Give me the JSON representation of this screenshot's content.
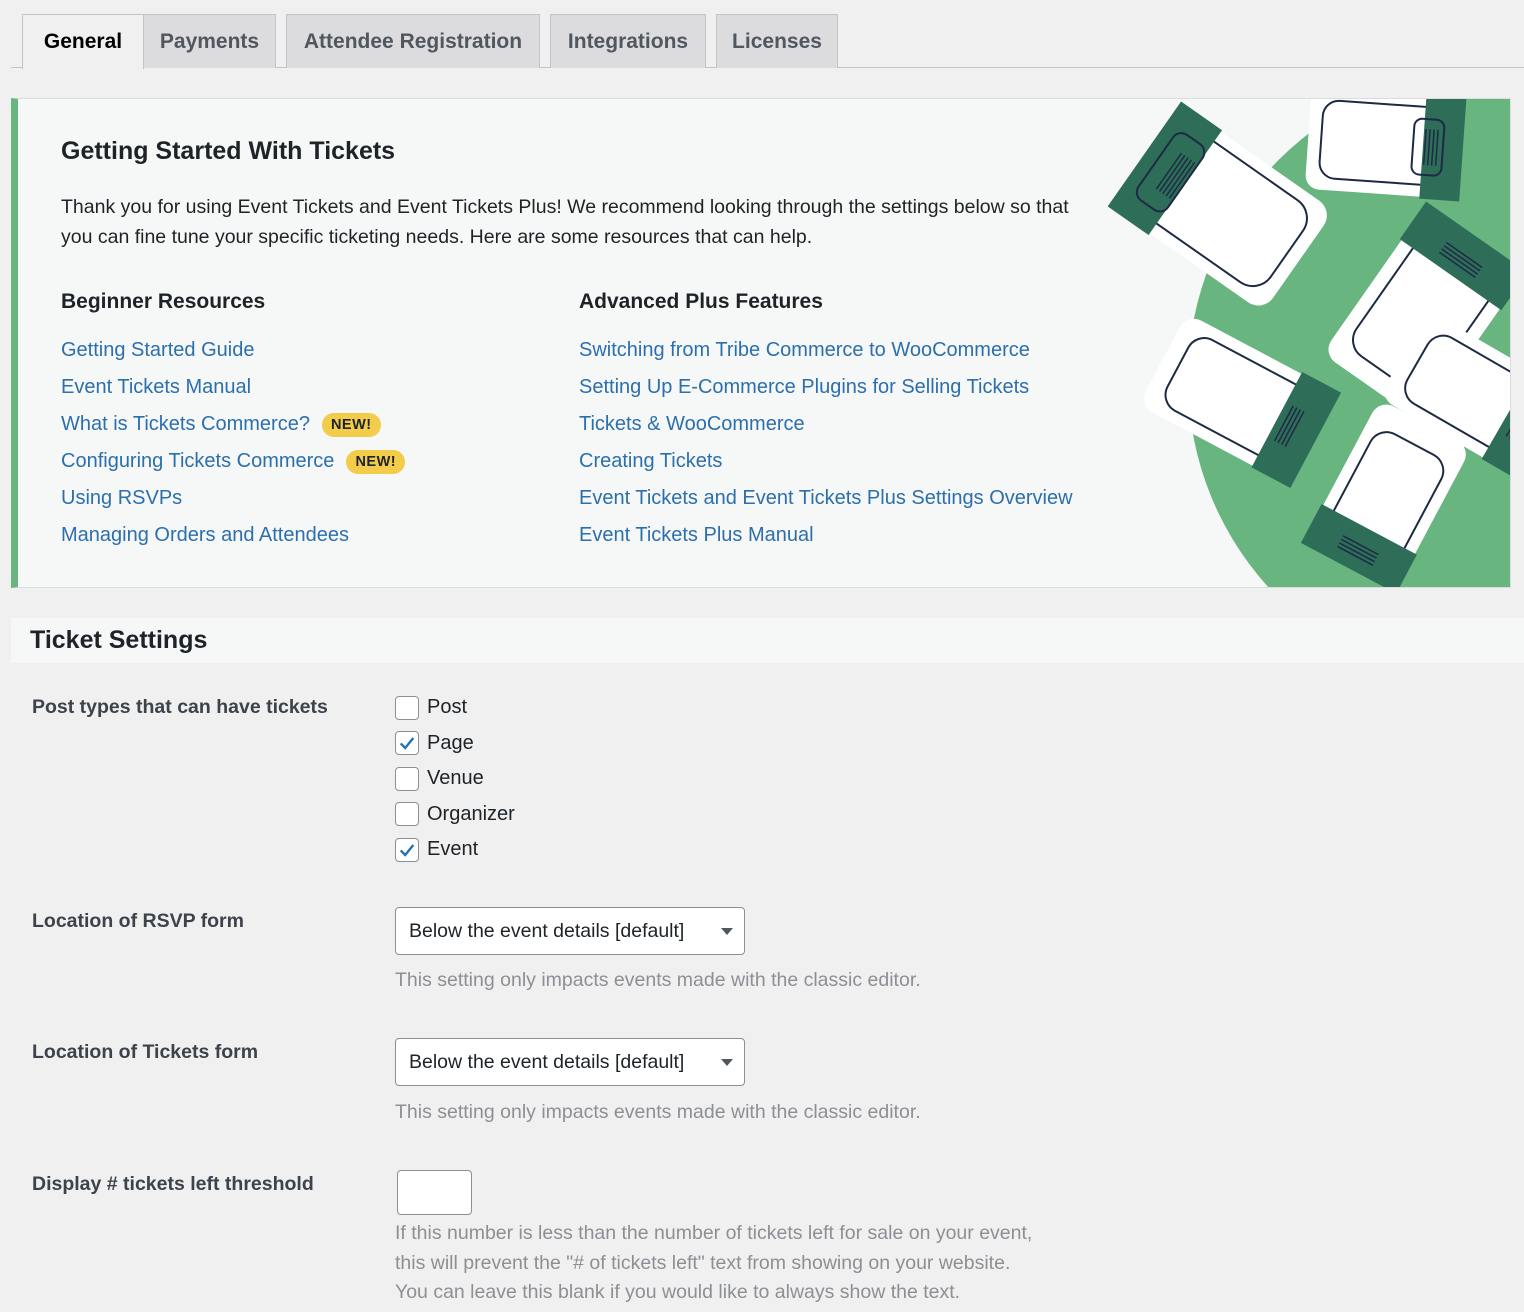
{
  "tabs": [
    {
      "label": "General",
      "active": true
    },
    {
      "label": "Payments"
    },
    {
      "label": "Attendee Registration"
    },
    {
      "label": "Integrations"
    },
    {
      "label": "Licenses"
    }
  ],
  "banner": {
    "title": "Getting Started With Tickets",
    "intro": "Thank you for using Event Tickets and Event Tickets Plus! We recommend looking through the settings below so that you can fine tune your specific ticketing needs. Here are some resources that can help.",
    "beginner": {
      "heading": "Beginner Resources",
      "links": [
        {
          "label": "Getting Started Guide"
        },
        {
          "label": "Event Tickets Manual"
        },
        {
          "label": "What is Tickets Commerce?",
          "badge": "NEW!"
        },
        {
          "label": "Configuring Tickets Commerce",
          "badge": "NEW!"
        },
        {
          "label": "Using RSVPs"
        },
        {
          "label": "Managing Orders and Attendees"
        }
      ]
    },
    "advanced": {
      "heading": "Advanced Plus Features",
      "links": [
        {
          "label": "Switching from Tribe Commerce to WooCommerce"
        },
        {
          "label": "Setting Up E-Commerce Plugins for Selling Tickets"
        },
        {
          "label": "Tickets & WooCommerce"
        },
        {
          "label": "Creating Tickets"
        },
        {
          "label": "Event Tickets and Event Tickets Plus Settings Overview"
        },
        {
          "label": "Event Tickets Plus Manual"
        }
      ]
    },
    "accent_color": "#68b580"
  },
  "settings": {
    "title": "Ticket Settings",
    "post_types": {
      "label": "Post types that can have tickets",
      "options": [
        {
          "label": "Post",
          "checked": false
        },
        {
          "label": "Page",
          "checked": true
        },
        {
          "label": "Venue",
          "checked": false
        },
        {
          "label": "Organizer",
          "checked": false
        },
        {
          "label": "Event",
          "checked": true
        }
      ]
    },
    "rsvp_location": {
      "label": "Location of RSVP form",
      "value": "Below the event details [default]",
      "description": "This setting only impacts events made with the classic editor."
    },
    "tickets_location": {
      "label": "Location of Tickets form",
      "value": "Below the event details [default]",
      "description": "This setting only impacts events made with the classic editor."
    },
    "threshold": {
      "label": "Display # tickets left threshold",
      "value": "",
      "description_lines": [
        "If this number is less than the number of tickets left for sale on your event,",
        "this will prevent the \"# of tickets left\" text from showing on your website.",
        "You can leave this blank if you would like to always show the text."
      ]
    }
  },
  "colors": {
    "link": "#2c6fad",
    "badge": "#f2cc4a",
    "checkbox_check": "#2271b1",
    "illustration_green": "#68b580",
    "illustration_dark_green": "#2e6e59"
  }
}
